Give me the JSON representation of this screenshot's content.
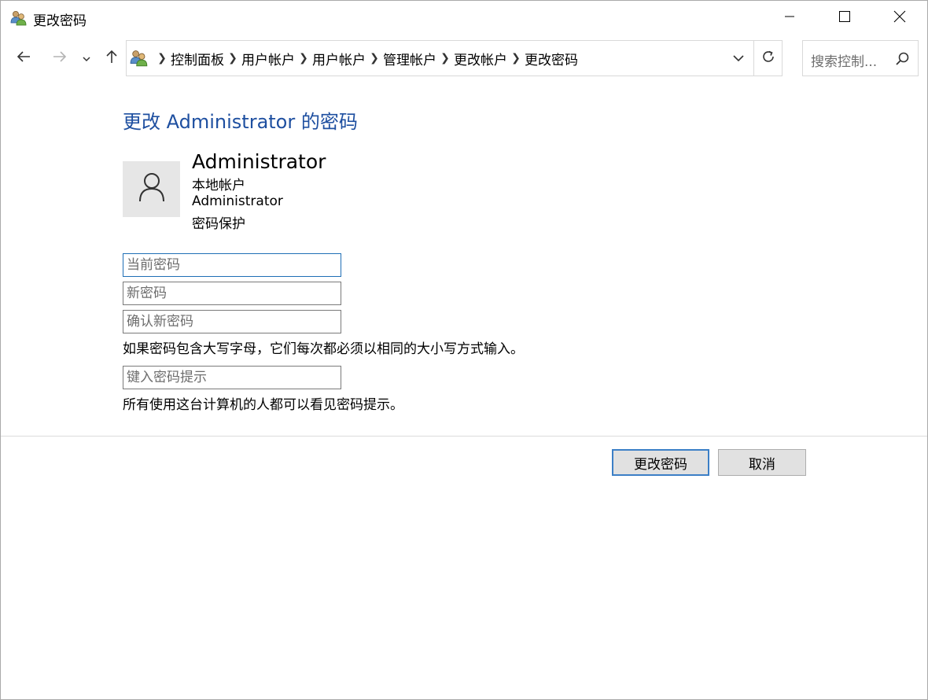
{
  "window": {
    "title": "更改密码"
  },
  "nav": {
    "breadcrumbs": [
      "控制面板",
      "用户帐户",
      "用户帐户",
      "管理帐户",
      "更改帐户",
      "更改密码"
    ],
    "search_placeholder": "搜索控制..."
  },
  "page": {
    "title": "更改 Administrator 的密码",
    "account": {
      "name": "Administrator",
      "type": "本地帐户",
      "username": "Administrator",
      "protection": "密码保护"
    },
    "fields": {
      "current_password_placeholder": "当前密码",
      "new_password_placeholder": "新密码",
      "confirm_password_placeholder": "确认新密码",
      "hint_placeholder": "键入密码提示"
    },
    "case_note": "如果密码包含大写字母，它们每次都必须以相同的大小写方式输入。",
    "hint_note": "所有使用这台计算机的人都可以看见密码提示。"
  },
  "buttons": {
    "change_password": "更改密码",
    "cancel": "取消"
  },
  "colors": {
    "title_blue": "#1e4fa0",
    "focus_border": "#1f6fb5",
    "primary_border": "#3c7fc6"
  }
}
